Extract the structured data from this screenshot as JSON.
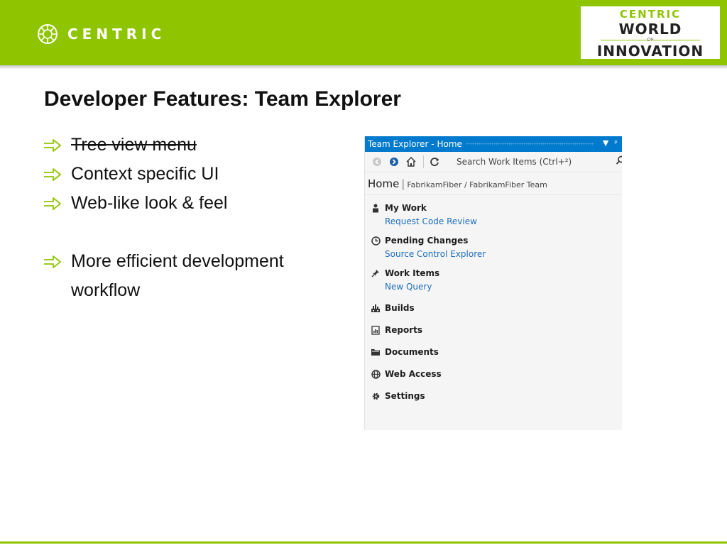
{
  "header": {
    "brand": "CENTRIC",
    "badge": {
      "line1": "CENTRIC",
      "line2": "WORLD",
      "line3": "OF",
      "line4": "INNOVATION"
    },
    "accent": "#8fc500"
  },
  "slide": {
    "title": "Developer Features: Team Explorer",
    "bullets": [
      {
        "text": "Tree view menu",
        "struck": true
      },
      {
        "text": "Context specific UI",
        "struck": false
      },
      {
        "text": "Web-like look & feel",
        "struck": false
      },
      {
        "text": "More efficient development workflow",
        "struck": false
      }
    ]
  },
  "team_explorer": {
    "title": "Team Explorer - Home",
    "search_placeholder": "Search Work Items (Ctrl+²)",
    "crumb_home": "Home",
    "crumb_path": "FabrikamFiber / FabrikamFiber Team",
    "sections": [
      {
        "label": "My Work",
        "icon": "person-icon",
        "link": "Request Code Review"
      },
      {
        "label": "Pending Changes",
        "icon": "clock-icon",
        "link": "Source Control Explorer"
      },
      {
        "label": "Work Items",
        "icon": "pin-icon",
        "link": "New Query"
      },
      {
        "label": "Builds",
        "icon": "build-icon"
      },
      {
        "label": "Reports",
        "icon": "report-icon"
      },
      {
        "label": "Documents",
        "icon": "folder-icon"
      },
      {
        "label": "Web Access",
        "icon": "globe-icon"
      },
      {
        "label": "Settings",
        "icon": "gear-icon"
      }
    ],
    "title_bar_color": "#007acc",
    "link_color": "#1e6ebd"
  }
}
